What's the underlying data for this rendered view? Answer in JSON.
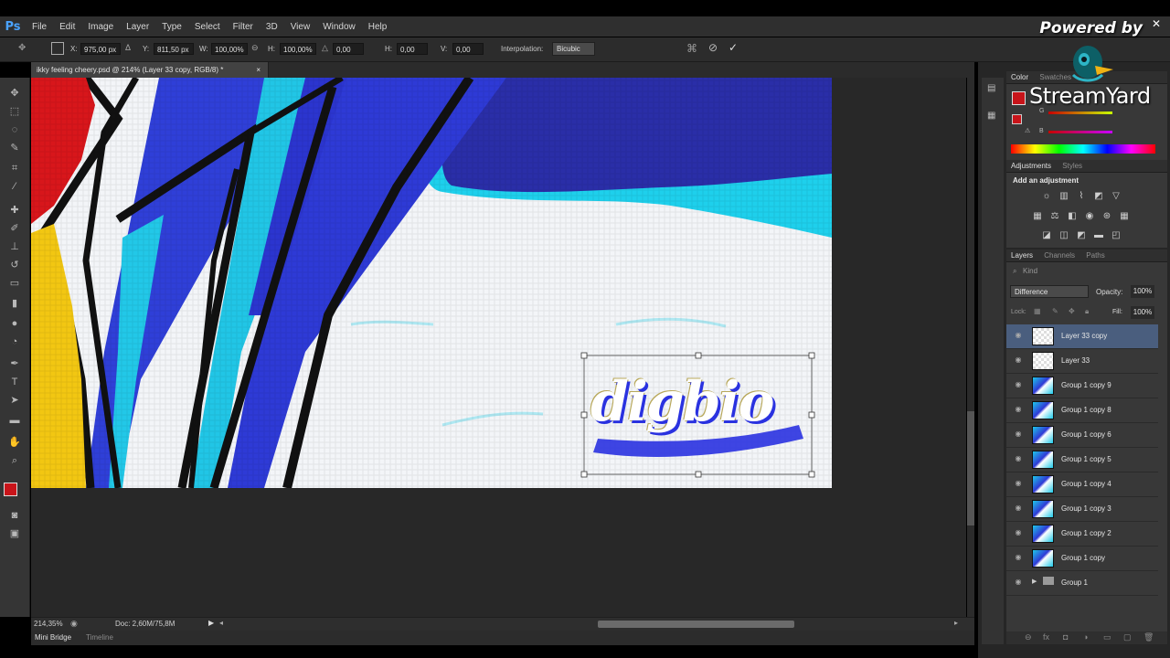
{
  "app": {
    "logo": "Ps",
    "close_glyph": "✕"
  },
  "menu": [
    "File",
    "Edit",
    "Image",
    "Layer",
    "Type",
    "Select",
    "Filter",
    "3D",
    "View",
    "Window",
    "Help"
  ],
  "options": {
    "x_label": "X:",
    "x_value": "975,00 px",
    "y_label": "Y:",
    "y_value": "811,50 px",
    "w_label": "W:",
    "w_value": "100,00%",
    "h_label": "H:",
    "h_value": "100,00%",
    "angle_value": "0,00",
    "hskew_label": "H:",
    "hskew_value": "0,00",
    "vskew_label": "V:",
    "vskew_value": "0,00",
    "interpolation_label": "Interpolation:",
    "interpolation_value": "Bicubic"
  },
  "document": {
    "tab_title": "ikky feeling cheery.psd @ 214% (Layer 33 copy, RGB/8) *",
    "tab_close": "×",
    "canvas_text": "digbio"
  },
  "status": {
    "zoom": "214,35%",
    "doc_info": "Doc: 2,60M/75,8M"
  },
  "bottom_tabs": [
    "Mini Bridge",
    "Timeline"
  ],
  "color_panel": {
    "tabs": [
      "Color",
      "Swatches"
    ],
    "channels": [
      "R",
      "G",
      "B"
    ],
    "foreground_color": "#c8141a",
    "background_color": "#ffffff"
  },
  "adjustments_panel": {
    "tabs": [
      "Adjustments",
      "Styles"
    ],
    "heading": "Add an adjustment"
  },
  "layers_panel": {
    "tabs": [
      "Layers",
      "Channels",
      "Paths"
    ],
    "filter_label": "Kind",
    "blend_mode": "Difference",
    "opacity_label": "Opacity:",
    "opacity_value": "100%",
    "lock_label": "Lock:",
    "fill_label": "Fill:",
    "fill_value": "100%",
    "layers": [
      {
        "name": "Layer 33 copy"
      },
      {
        "name": "Layer 33"
      },
      {
        "name": "Group 1 copy 9"
      },
      {
        "name": "Group 1 copy 8"
      },
      {
        "name": "Group 1 copy 6"
      },
      {
        "name": "Group 1 copy 5"
      },
      {
        "name": "Group 1 copy 4"
      },
      {
        "name": "Group 1 copy 3"
      },
      {
        "name": "Group 1 copy 2"
      },
      {
        "name": "Group 1 copy"
      },
      {
        "name": "Group 1"
      }
    ]
  },
  "overlay": {
    "powered_by": "Powered by",
    "brand": "StreamYard",
    "close_glyph": "✕"
  },
  "colors": {
    "accent_blue": "#2f39d6",
    "accent_cyan": "#1ec8e8",
    "selected_layer": "#4a5e7e"
  }
}
